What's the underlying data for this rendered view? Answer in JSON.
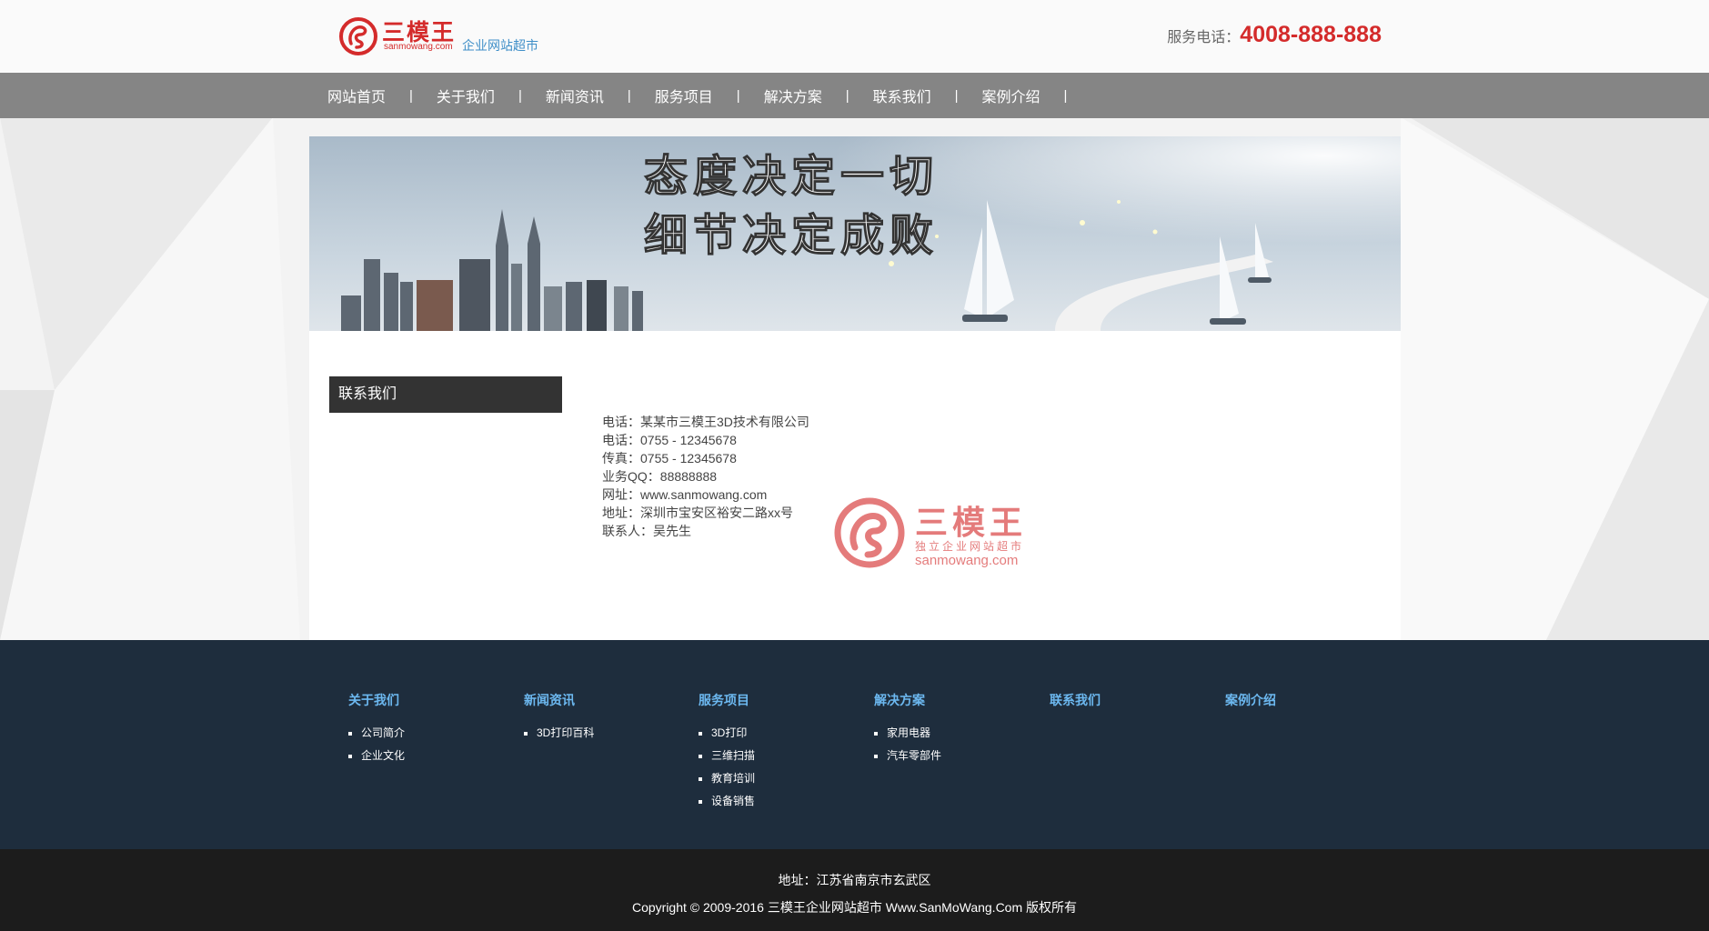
{
  "header": {
    "logo_name": "三模王",
    "logo_domain": "sanmowang.com",
    "logo_tagline": "企业网站超市",
    "hotline_label": "服务电话：",
    "hotline_number": "4008-888-888"
  },
  "nav": {
    "items": [
      "网站首页",
      "关于我们",
      "新闻资讯",
      "服务项目",
      "解决方案",
      "联系我们",
      "案例介绍"
    ],
    "separator": "|"
  },
  "banner": {
    "line1": "态度决定一切",
    "line2": "细节决定成败"
  },
  "sidebar": {
    "title": "联系我们"
  },
  "contact": {
    "lines": [
      "电话：某某市三模王3D技术有限公司",
      "电话：0755 - 12345678",
      "传真：0755 - 12345678",
      "业务QQ：88888888",
      "网址：www.sanmowang.com",
      "地址：深圳市宝安区裕安二路xx号",
      "联系人：吴先生"
    ],
    "stamp_name": "三模王",
    "stamp_sub": "独立企业网站超市",
    "stamp_domain": "sanmowang.com"
  },
  "footer": {
    "columns": [
      {
        "title": "关于我们",
        "items": [
          "公司简介",
          "企业文化"
        ]
      },
      {
        "title": "新闻资讯",
        "items": [
          "3D打印百科"
        ]
      },
      {
        "title": "服务项目",
        "items": [
          "3D打印",
          "三维扫描",
          "教育培训",
          "设备销售"
        ]
      },
      {
        "title": "解决方案",
        "items": [
          "家用电器",
          "汽车零部件"
        ]
      },
      {
        "title": "联系我们",
        "items": []
      },
      {
        "title": "案例介绍",
        "items": []
      }
    ],
    "address": "地址：江苏省南京市玄武区",
    "copyright": "Copyright © 2009-2016 三模王企业网站超市 Www.SanMoWang.Com 版权所有"
  },
  "colors": {
    "brand_red": "#d42b2b",
    "nav_gray": "#858585",
    "footer_navy": "#1e2d3d",
    "footer_link_blue": "#6cb8f0",
    "bottom_black": "#1c1c1c"
  }
}
